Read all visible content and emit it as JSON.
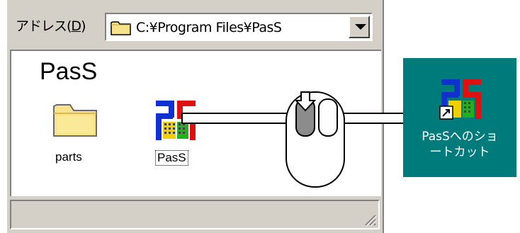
{
  "addressbar": {
    "label_prefix": "アドレス(",
    "label_accel": "D",
    "label_suffix": ")",
    "path": "C:¥Program Files¥PasS"
  },
  "folder": {
    "title": "PasS"
  },
  "items": [
    {
      "label": "parts",
      "icon": "folder-icon"
    },
    {
      "label": "PasS",
      "icon": "pass-app-icon",
      "selected": true
    }
  ],
  "desktop": {
    "shortcut_label_line1": "PasSへのショ",
    "shortcut_label_line2": "ートカット",
    "background": "#007b7b"
  },
  "colors": {
    "window_face": "#d4d0c8",
    "desktop_teal": "#007b7b"
  }
}
